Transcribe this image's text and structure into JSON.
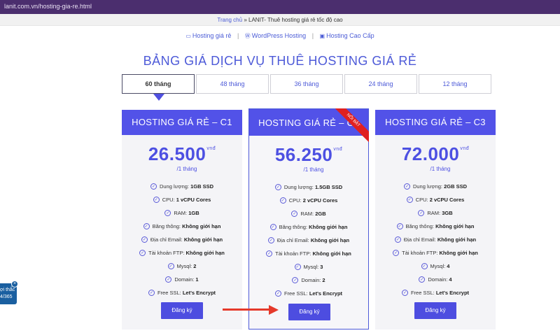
{
  "browser": {
    "url": "lanit.com.vn/hosting-gia-re.html"
  },
  "breadcrumb": {
    "home": "Trang chủ",
    "separator": "»",
    "current": "LANIT- Thuê hosting giá rẻ tốc độ cao"
  },
  "subnav": [
    {
      "icon": "server-icon",
      "label": "Hosting giá rẻ"
    },
    {
      "icon": "wordpress-icon",
      "label": "WordPress Hosting"
    },
    {
      "icon": "hosting-icon",
      "label": "Hosting Cao Cấp"
    }
  ],
  "page_title": "BẢNG GIÁ DỊCH VỤ THUÊ HOSTING GIÁ RẺ",
  "tabs": [
    "60 tháng",
    "48 tháng",
    "36 tháng",
    "24 tháng",
    "12 tháng"
  ],
  "active_tab": "60 tháng",
  "currency": "vnđ",
  "period": "/1 tháng",
  "ribbon": "NỔI BẬT",
  "plans": [
    {
      "name": "HOSTING GIÁ RẺ – C1",
      "price": "26.500",
      "features": [
        {
          "label": "Dung lượng:",
          "value": "1GB SSD"
        },
        {
          "label": "CPU:",
          "value": "1 vCPU Cores"
        },
        {
          "label": "RAM:",
          "value": "1GB"
        },
        {
          "label": "Băng thông:",
          "value": "Không giới hạn"
        },
        {
          "label": "Địa chỉ Email:",
          "value": "Không giới hạn"
        },
        {
          "label": "Tài khoản FTP:",
          "value": "Không giới hạn"
        },
        {
          "label": "Mysql:",
          "value": "2"
        },
        {
          "label": "Domain:",
          "value": "1"
        },
        {
          "label": "Free SSL:",
          "value": "Let's Encrypt"
        }
      ],
      "button": "Đăng ký"
    },
    {
      "name": "HOSTING GIÁ RẺ – C2",
      "price": "56.250",
      "features": [
        {
          "label": "Dung lượng:",
          "value": "1.5GB SSD"
        },
        {
          "label": "CPU:",
          "value": "2 vCPU Cores"
        },
        {
          "label": "RAM:",
          "value": "2GB"
        },
        {
          "label": "Băng thông:",
          "value": "Không giới hạn"
        },
        {
          "label": "Địa chỉ Email:",
          "value": "Không giới hạn"
        },
        {
          "label": "Tài khoản FTP:",
          "value": "Không giới hạn"
        },
        {
          "label": "Mysql:",
          "value": "3"
        },
        {
          "label": "Domain:",
          "value": "2"
        },
        {
          "label": "Free SSL:",
          "value": "Let's Encrypt"
        }
      ],
      "button": "Đăng ký"
    },
    {
      "name": "HOSTING GIÁ RẺ – C3",
      "price": "72.000",
      "features": [
        {
          "label": "Dung lượng:",
          "value": "2GB SSD"
        },
        {
          "label": "CPU:",
          "value": "2 vCPU Cores"
        },
        {
          "label": "RAM:",
          "value": "3GB"
        },
        {
          "label": "Băng thông:",
          "value": "Không giới hạn"
        },
        {
          "label": "Địa chỉ Email:",
          "value": "Không giới hạn"
        },
        {
          "label": "Tài khoản FTP:",
          "value": "Không giới hạn"
        },
        {
          "label": "Mysql:",
          "value": "4"
        },
        {
          "label": "Domain:",
          "value": "4"
        },
        {
          "label": "Free SSL:",
          "value": "Let's Encrypt"
        }
      ],
      "button": "Đăng ký"
    }
  ],
  "chat_widget": {
    "line1": "ợi thắc",
    "line2": "4/365"
  },
  "colors": {
    "brand": "#5252e8",
    "ribbon": "#e02020",
    "arrow": "#e5392b"
  }
}
